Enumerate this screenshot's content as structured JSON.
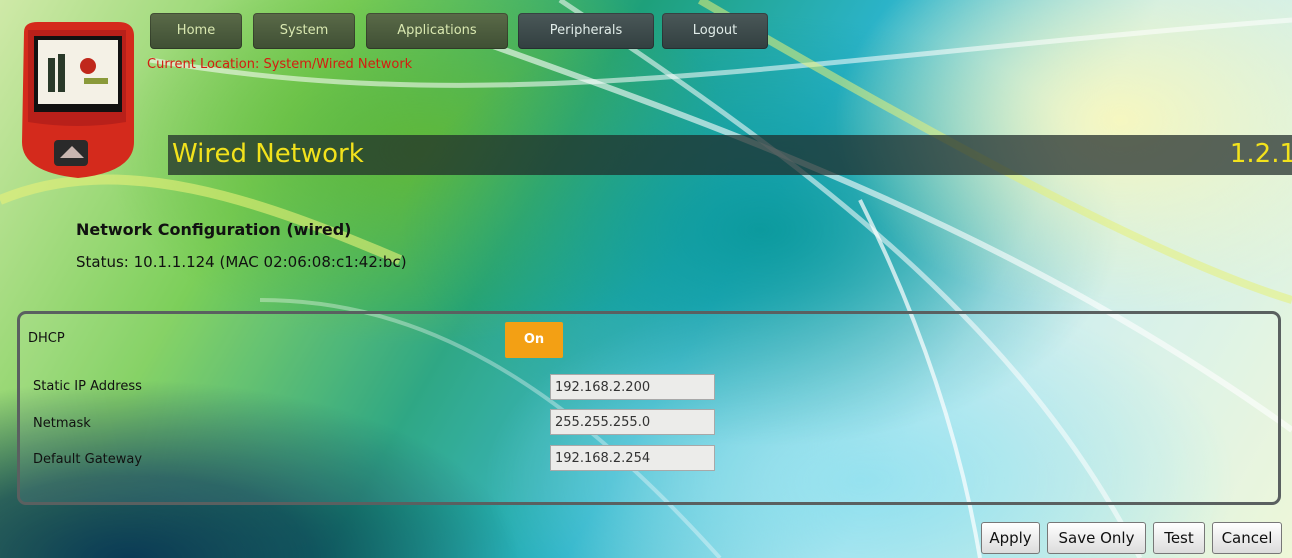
{
  "nav": {
    "items": [
      {
        "label": "Home"
      },
      {
        "label": "System"
      },
      {
        "label": "Applications"
      },
      {
        "label": "Peripherals"
      },
      {
        "label": "Logout"
      }
    ]
  },
  "location": "Current Location: System/Wired Network",
  "page": {
    "title": "Wired Network",
    "version": "1.2.1"
  },
  "section": {
    "heading": "Network Configuration (wired)",
    "status": "Status: 10.1.1.124 (MAC 02:06:08:c1:42:bc)"
  },
  "form": {
    "dhcp_label": "DHCP",
    "dhcp_toggle": "On",
    "static_ip_label": "Static IP Address",
    "static_ip_value": "192.168.2.200",
    "netmask_label": "Netmask",
    "netmask_value": "255.255.255.0",
    "gateway_label": "Default Gateway",
    "gateway_value": "192.168.2.254"
  },
  "actions": {
    "apply": "Apply",
    "save_only": "Save Only",
    "test": "Test",
    "cancel": "Cancel"
  },
  "colors": {
    "accent_yellow": "#f2e21c",
    "location_red": "#d41c10",
    "toggle_orange": "#f3a014",
    "kiosk_red": "#d42a1c"
  }
}
